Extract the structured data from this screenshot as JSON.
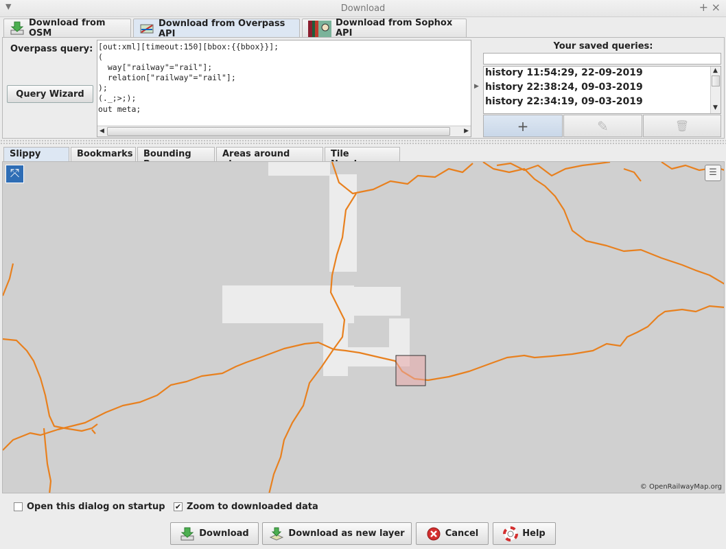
{
  "window": {
    "title": "Download"
  },
  "top_tabs": [
    {
      "label": "Download from OSM",
      "icon": "download-osm-icon"
    },
    {
      "label": "Download from Overpass API",
      "icon": "overpass-icon",
      "selected": true
    },
    {
      "label": "Download from Sophox API",
      "icon": "sophox-icon"
    }
  ],
  "query": {
    "label": "Overpass query:",
    "wizard_label": "Query Wizard",
    "lines": [
      "[out:xml][timeout:150][bbox:{{bbox}}];",
      "(",
      "  way[\"railway\"=\"rail\"];",
      "  relation[\"railway\"=\"rail\"];",
      ");",
      "(._;>;);",
      "out meta;"
    ]
  },
  "saved": {
    "title": "Your saved queries:",
    "filter_value": "",
    "items": [
      "history 11:54:29, 22-09-2019",
      "history 22:38:24, 09-03-2019",
      "history 22:34:19, 09-03-2019"
    ],
    "buttons": [
      {
        "icon": "add-icon",
        "glyph": "+"
      },
      {
        "icon": "edit-icon",
        "glyph": "✎"
      },
      {
        "icon": "delete-icon",
        "glyph": "🗑"
      }
    ]
  },
  "map_tabs": [
    {
      "label": "Slippy map",
      "selected": true
    },
    {
      "label": "Bookmarks"
    },
    {
      "label": "Bounding Box"
    },
    {
      "label": "Areas around places"
    },
    {
      "label": "Tile Numbers"
    }
  ],
  "map": {
    "attribution": "© OpenRailwayMap.org",
    "rail_color": "#e8801e",
    "selection_color": "#e8a8a8"
  },
  "options": {
    "open_on_startup": {
      "label": "Open this dialog on startup",
      "checked": false
    },
    "zoom_to_data": {
      "label": "Zoom to downloaded data",
      "checked": true
    }
  },
  "buttons": {
    "download": "Download",
    "download_new_layer": "Download as new layer",
    "cancel": "Cancel",
    "help": "Help"
  }
}
